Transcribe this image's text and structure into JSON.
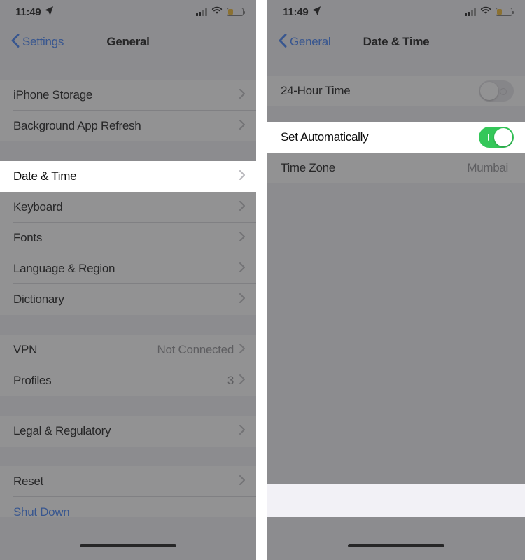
{
  "colors": {
    "accent_blue": "#3478f6",
    "toggle_on_green": "#34c759",
    "battery_yellow": "#f0b323",
    "value_gray": "#8a8a8e",
    "dim_overlay": "rgba(60,60,62,0.56)"
  },
  "left_screen": {
    "status_bar": {
      "time": "11:49",
      "location_icon": "location-arrow-icon",
      "signal_icon": "cellular-signal-icon",
      "signal_bars_filled": 2,
      "signal_bars_total": 4,
      "wifi_icon": "wifi-icon",
      "battery_icon": "battery-low-icon"
    },
    "nav": {
      "back_label": "Settings",
      "back_icon": "chevron-left-icon",
      "title": "General"
    },
    "sections": [
      {
        "rows": [
          {
            "label": "iPhone Storage",
            "value": "",
            "accessory": "chevron",
            "highlighted": false
          },
          {
            "label": "Background App Refresh",
            "value": "",
            "accessory": "chevron",
            "highlighted": false
          }
        ]
      },
      {
        "rows": [
          {
            "label": "Date & Time",
            "value": "",
            "accessory": "chevron",
            "highlighted": true
          }
        ]
      },
      {
        "rows": [
          {
            "label": "Keyboard",
            "value": "",
            "accessory": "chevron",
            "highlighted": false
          },
          {
            "label": "Fonts",
            "value": "",
            "accessory": "chevron",
            "highlighted": false
          },
          {
            "label": "Language & Region",
            "value": "",
            "accessory": "chevron",
            "highlighted": false
          },
          {
            "label": "Dictionary",
            "value": "",
            "accessory": "chevron",
            "highlighted": false
          }
        ]
      },
      {
        "rows": [
          {
            "label": "VPN",
            "value": "Not Connected",
            "accessory": "chevron",
            "highlighted": false
          },
          {
            "label": "Profiles",
            "value": "3",
            "accessory": "chevron",
            "highlighted": false
          }
        ]
      },
      {
        "rows": [
          {
            "label": "Legal & Regulatory",
            "value": "",
            "accessory": "chevron",
            "highlighted": false
          }
        ]
      },
      {
        "rows": [
          {
            "label": "Reset",
            "value": "",
            "accessory": "chevron",
            "highlighted": false
          },
          {
            "label": "Shut Down",
            "value": "",
            "accessory": "none",
            "highlighted": false,
            "style": "blue"
          }
        ]
      }
    ],
    "home_indicator": "home-indicator"
  },
  "right_screen": {
    "status_bar": {
      "time": "11:49",
      "location_icon": "location-arrow-icon",
      "signal_icon": "cellular-signal-icon",
      "signal_bars_filled": 2,
      "signal_bars_total": 4,
      "wifi_icon": "wifi-icon",
      "battery_icon": "battery-low-icon"
    },
    "nav": {
      "back_label": "General",
      "back_icon": "chevron-left-icon",
      "title": "Date & Time"
    },
    "sections": [
      {
        "rows": [
          {
            "label": "24-Hour Time",
            "value": "",
            "accessory": "toggle",
            "toggle_state": "off",
            "highlighted": false
          }
        ]
      },
      {
        "rows": [
          {
            "label": "Set Automatically",
            "value": "",
            "accessory": "toggle",
            "toggle_state": "on",
            "highlighted": true
          },
          {
            "label": "Time Zone",
            "value": "Mumbai",
            "accessory": "none",
            "highlighted": false
          }
        ]
      }
    ],
    "home_indicator": "home-indicator"
  }
}
